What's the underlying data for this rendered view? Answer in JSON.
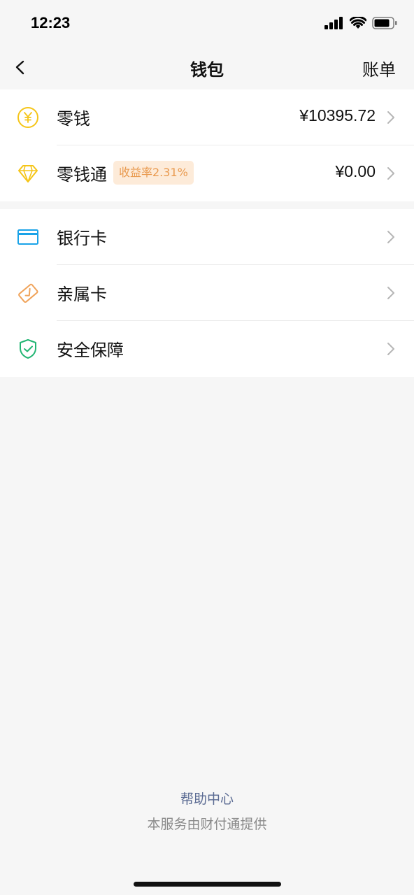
{
  "status_bar": {
    "time": "12:23"
  },
  "nav": {
    "title": "钱包",
    "right_label": "账单"
  },
  "group1": [
    {
      "label": "零钱",
      "value": "¥10395.72",
      "icon": "yuan-coin-icon"
    },
    {
      "label": "零钱通",
      "badge": "收益率2.31%",
      "value": "¥0.00",
      "icon": "diamond-icon"
    }
  ],
  "group2": [
    {
      "label": "银行卡",
      "icon": "bank-card-icon"
    },
    {
      "label": "亲属卡",
      "icon": "family-card-icon"
    },
    {
      "label": "安全保障",
      "icon": "shield-check-icon"
    }
  ],
  "footer": {
    "help": "帮助中心",
    "provider": "本服务由财付通提供"
  },
  "colors": {
    "accent_yellow": "#f5c518",
    "accent_blue": "#1aa3e8",
    "accent_orange": "#f0a35a",
    "accent_green": "#22b573",
    "link": "#5b6b93"
  }
}
